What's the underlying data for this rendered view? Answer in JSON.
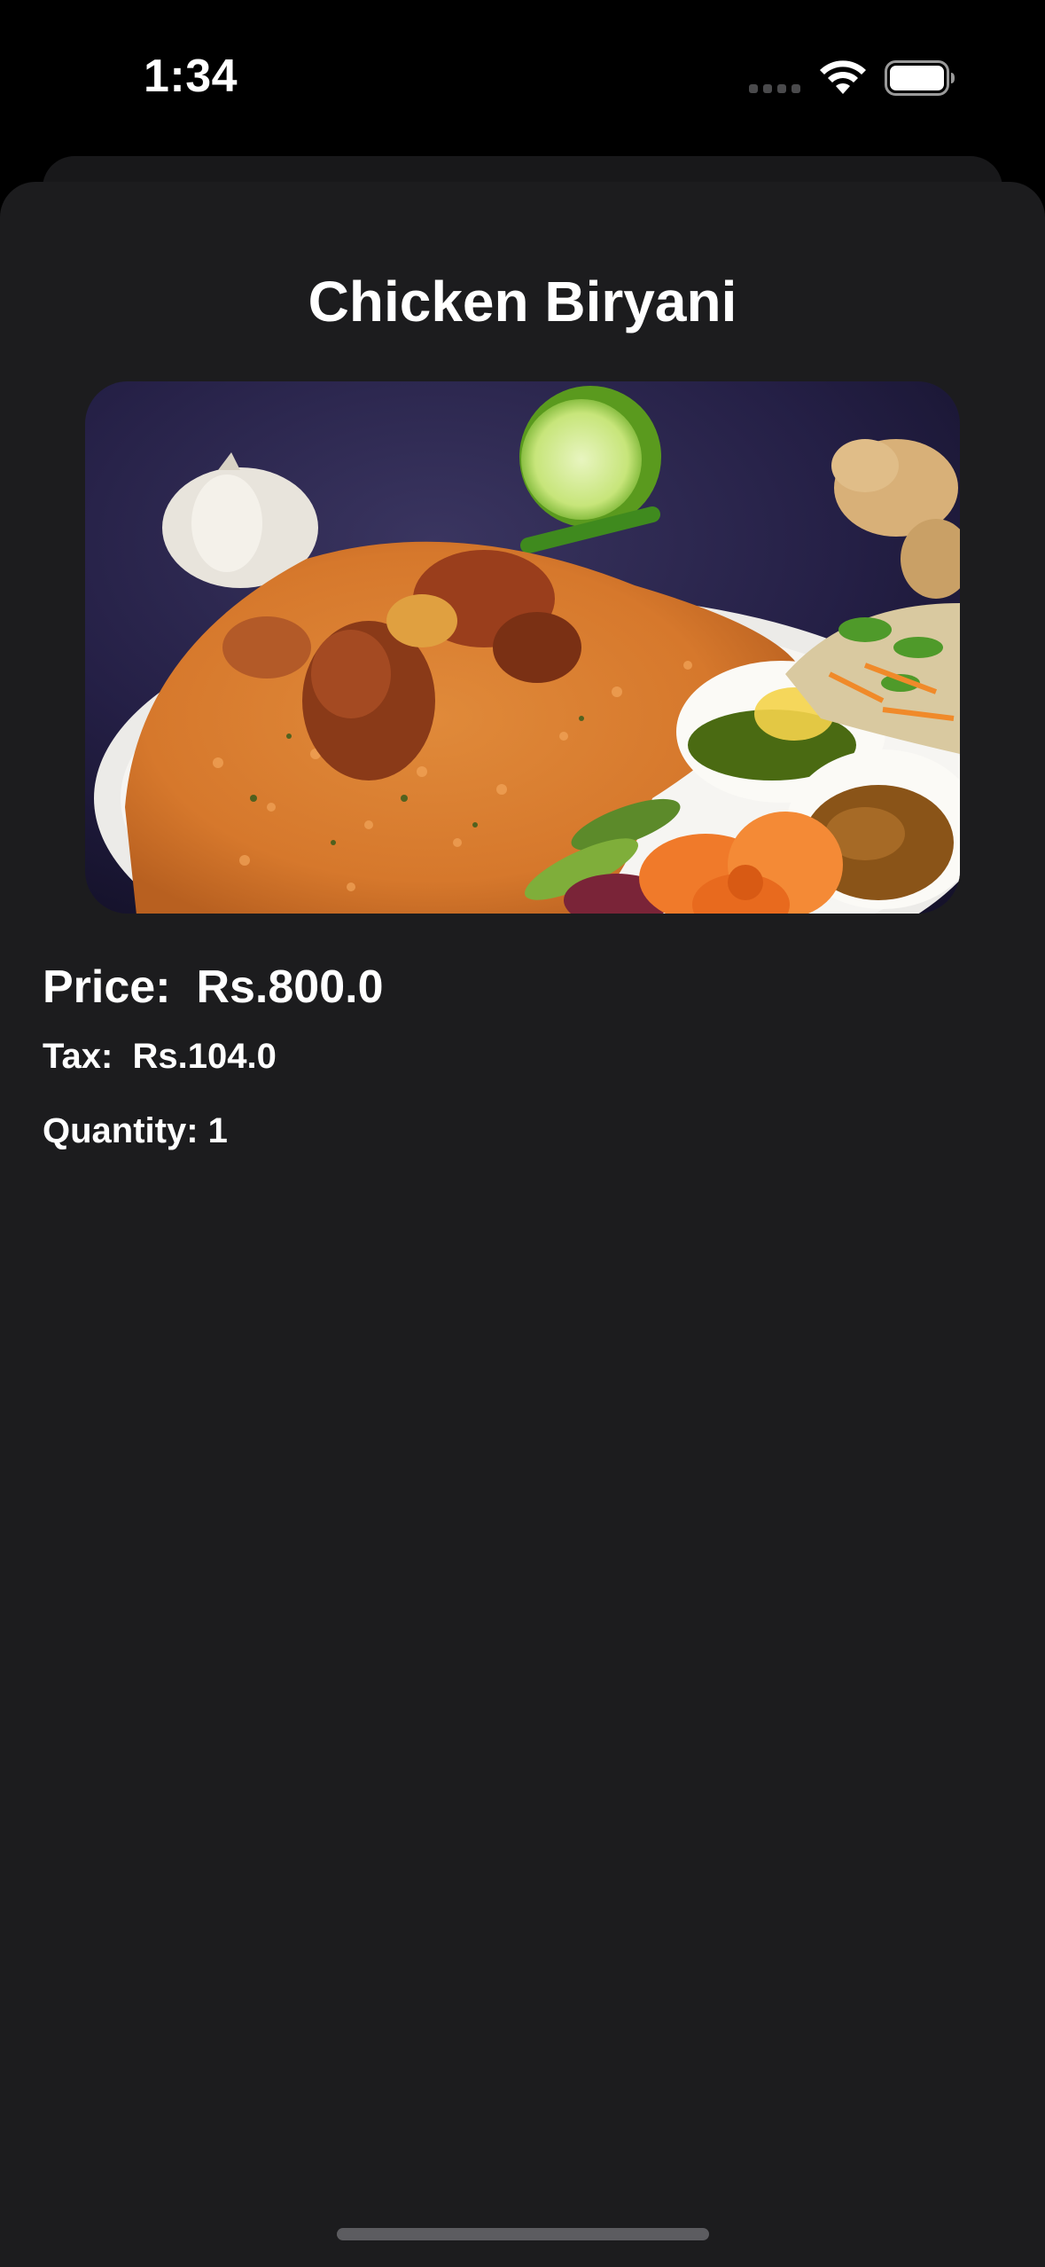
{
  "status_bar": {
    "time": "1:34",
    "signal_icon": "cellular-signal-icon",
    "wifi_icon": "wifi-icon",
    "battery_icon": "battery-icon"
  },
  "product": {
    "title": "Chicken Biryani",
    "image_alt": "biryani-photo",
    "price_label": "Price:",
    "price_value": "Rs.800.0",
    "tax_label": "Tax:",
    "tax_value": "Rs.104.0",
    "quantity_label": "Quantity:",
    "quantity_value": "1"
  },
  "colors": {
    "background": "#000000",
    "sheet": "#1c1c1e",
    "text": "#ffffff"
  }
}
